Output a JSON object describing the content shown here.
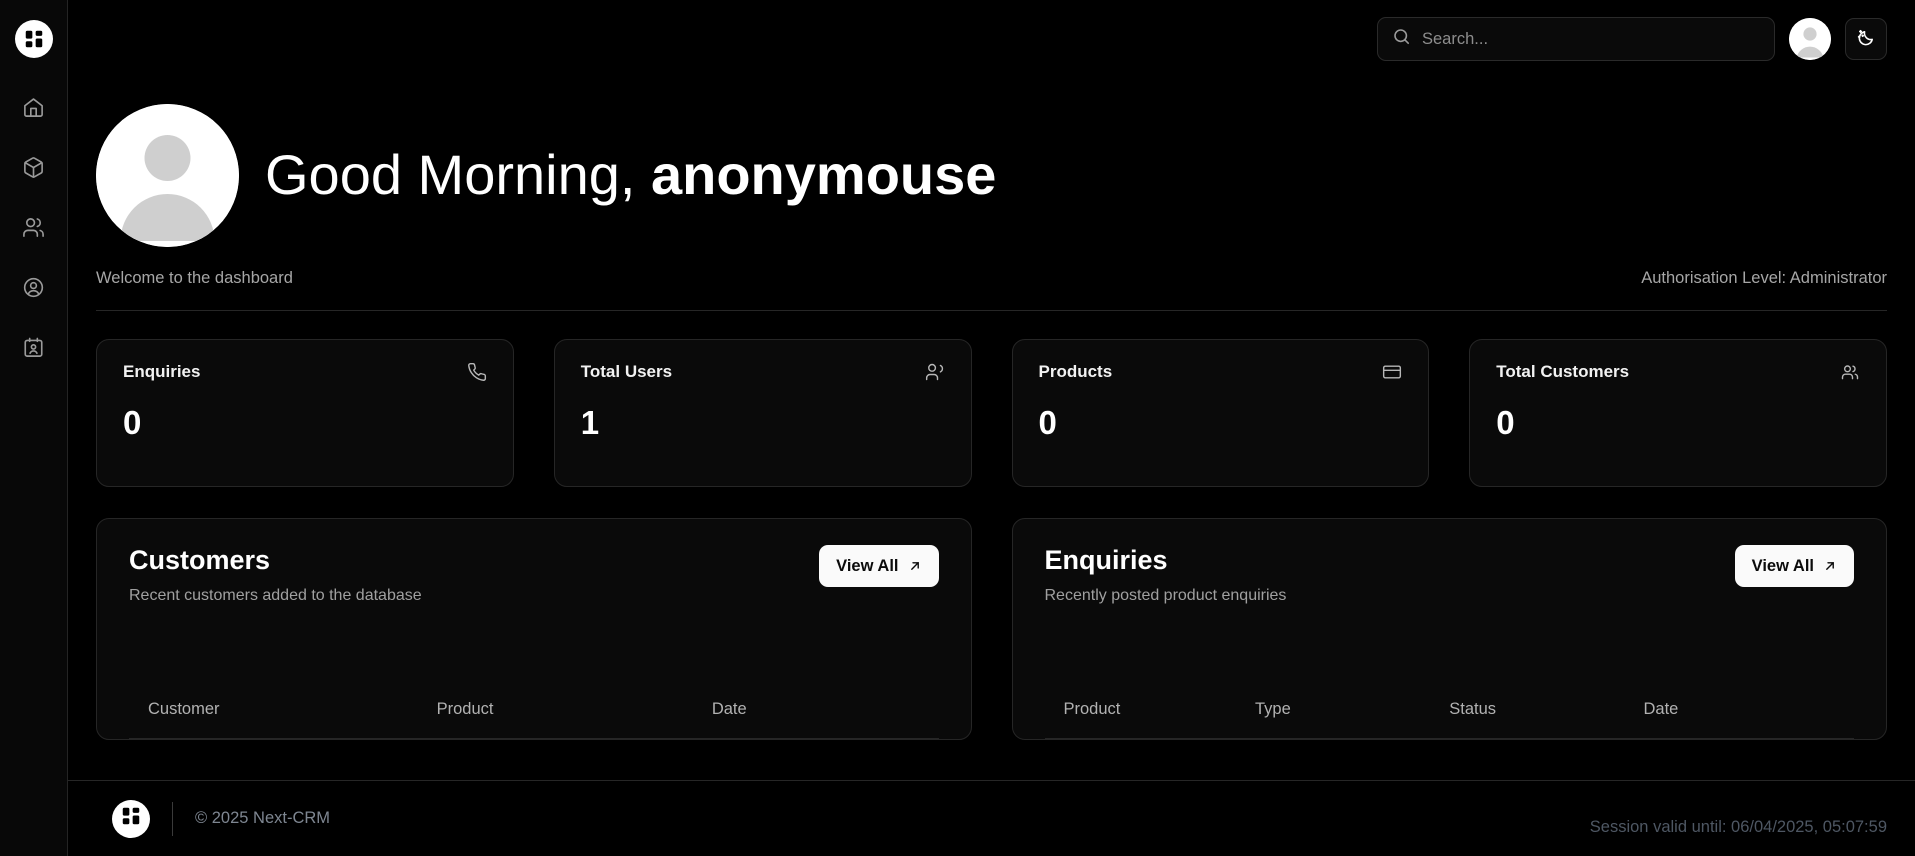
{
  "brand": {
    "name": "Next-CRM",
    "logo_icon": "layout-dashboard-icon"
  },
  "sidebar": {
    "items": [
      {
        "icon": "home-icon",
        "name": "sidebar-item-home"
      },
      {
        "icon": "package-icon",
        "name": "sidebar-item-products"
      },
      {
        "icon": "users-icon",
        "name": "sidebar-item-users"
      },
      {
        "icon": "circle-user-icon",
        "name": "sidebar-item-account"
      },
      {
        "icon": "contact-card-icon",
        "name": "sidebar-item-contacts"
      }
    ]
  },
  "topbar": {
    "search": {
      "placeholder": "Search...",
      "value": "",
      "icon": "search-icon"
    },
    "avatar_icon": "user-avatar-icon",
    "theme_toggle_icon": "moon-stars-icon"
  },
  "header": {
    "greeting_prefix": "Good Morning, ",
    "username": "anonymouse",
    "avatar_icon": "user-avatar-icon",
    "welcome": "Welcome to the dashboard",
    "authorisation": "Authorisation Level: Administrator"
  },
  "stats": [
    {
      "title": "Enquiries",
      "value": "0",
      "icon": "phone-icon"
    },
    {
      "title": "Total Users",
      "value": "1",
      "icon": "user-plus-icon"
    },
    {
      "title": "Products",
      "value": "0",
      "icon": "credit-card-icon"
    },
    {
      "title": "Total Customers",
      "value": "0",
      "icon": "users-icon"
    }
  ],
  "panels": {
    "customers": {
      "title": "Customers",
      "subtitle": "Recent customers added to the database",
      "view_all_label": "View All",
      "view_all_icon": "arrow-up-right-icon",
      "columns": [
        "Customer",
        "Product",
        "Date"
      ],
      "rows": []
    },
    "enquiries": {
      "title": "Enquiries",
      "subtitle": "Recently posted product enquiries",
      "view_all_label": "View All",
      "view_all_icon": "arrow-up-right-icon",
      "columns": [
        "Product",
        "Type",
        "Status",
        "Date"
      ],
      "rows": []
    }
  },
  "footer": {
    "copyright": "© 2025 Next-CRM",
    "session": "Session valid until: 06/04/2025, 05:07:59",
    "logo_icon": "layout-dashboard-icon"
  },
  "colors": {
    "background": "#000000",
    "surface": "#0a0a0a",
    "border": "#262626",
    "text_primary": "#ffffff",
    "text_muted": "#a6a6a6",
    "accent_button_bg": "#fafafa",
    "footer_text": "#7e8691",
    "session_text": "#4e5763"
  }
}
